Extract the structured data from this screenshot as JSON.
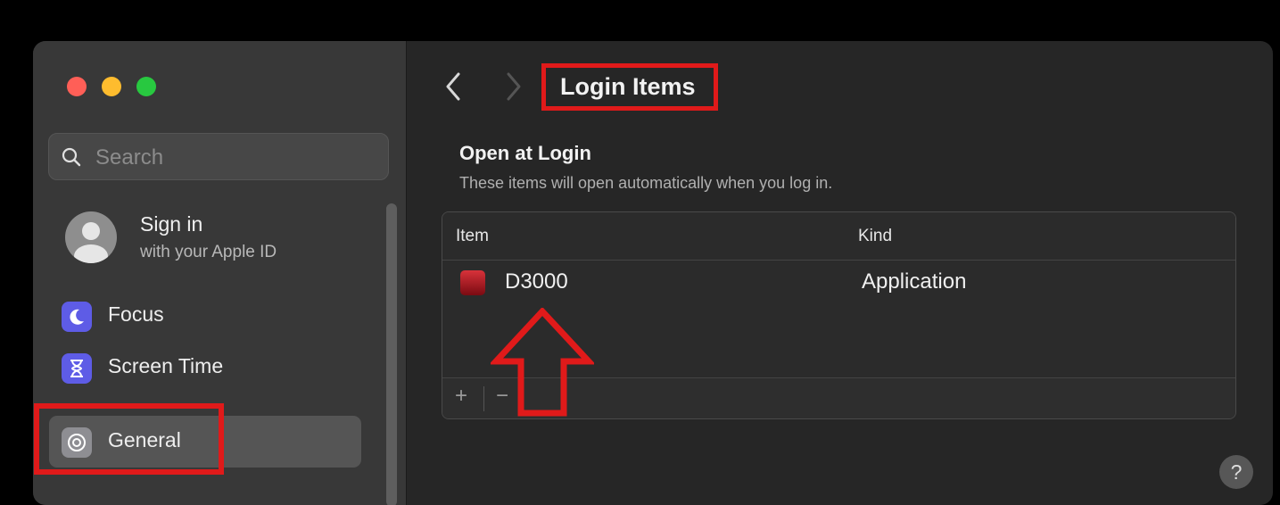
{
  "sidebar": {
    "search_placeholder": "Search",
    "signin_title": "Sign in",
    "signin_subtitle": "with your Apple ID",
    "items": [
      {
        "label": "Focus",
        "icon": "moon-icon",
        "color": "#5e5ce6"
      },
      {
        "label": "Screen Time",
        "icon": "hourglass-icon",
        "color": "#5e5ce6"
      },
      {
        "label": "General",
        "icon": "gear-icon",
        "color": "#8e8e93",
        "selected": true
      }
    ]
  },
  "main": {
    "title": "Login Items",
    "section_title": "Open at Login",
    "section_subtitle": "These items will open automatically when you log in.",
    "table": {
      "columns": [
        "Item",
        "Kind"
      ],
      "rows": [
        {
          "item": "D3000",
          "kind": "Application"
        }
      ],
      "add_label": "+",
      "remove_label": "−"
    },
    "help_label": "?"
  },
  "colors": {
    "annotation": "#e01a1a",
    "window": "#262626",
    "sidebar": "#383838"
  }
}
